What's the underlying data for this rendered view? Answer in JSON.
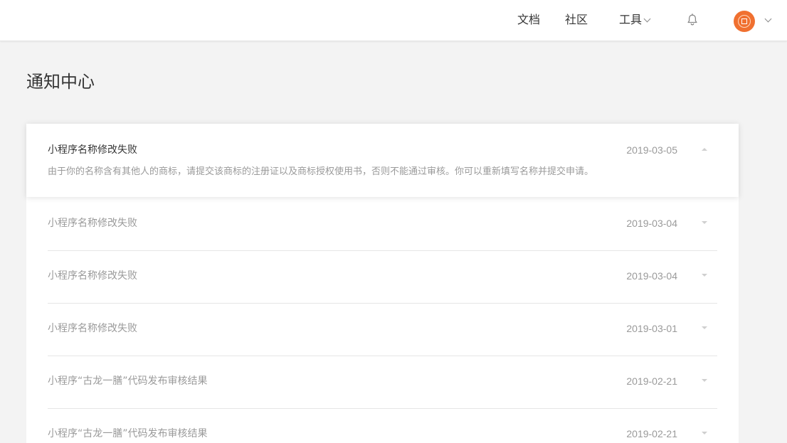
{
  "header": {
    "nav": [
      {
        "label": "文档"
      },
      {
        "label": "社区"
      },
      {
        "label": "工具"
      }
    ]
  },
  "page": {
    "title": "通知中心"
  },
  "notifications": [
    {
      "title": "小程序名称修改失败",
      "date": "2019-03-05",
      "body": "由于你的名称含有其他人的商标，请提交该商标的注册证以及商标授权使用书，否则不能通过审核。你可以重新填写名称并提交申请。",
      "expanded": true
    },
    {
      "title": "小程序名称修改失败",
      "date": "2019-03-04"
    },
    {
      "title": "小程序名称修改失败",
      "date": "2019-03-04"
    },
    {
      "title": "小程序名称修改失败",
      "date": "2019-03-01"
    },
    {
      "title": "小程序“古龙一膳”代码发布审核结果",
      "date": "2019-02-21"
    },
    {
      "title": "小程序“古龙一膳”代码发布审核结果",
      "date": "2019-02-21"
    }
  ],
  "icons": {
    "bell": "bell-icon",
    "avatar": "user-avatar",
    "dropdown": "chevron-down-icon",
    "expand": "caret-icon"
  },
  "colors": {
    "header_bg": "#ffffff",
    "page_bg": "#f3f3f3",
    "avatar": "#f07030",
    "muted_text": "#9a9a9a"
  }
}
